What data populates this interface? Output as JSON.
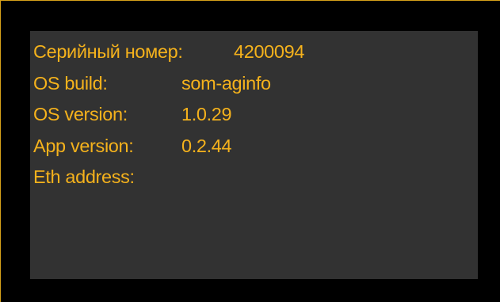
{
  "colors": {
    "background": "#000000",
    "panel": "#323232",
    "text": "#f5b21c",
    "frame_line": "#d7a21a"
  },
  "info": {
    "rows": [
      {
        "label": "Серийный номер:",
        "value": "4200094"
      },
      {
        "label": "OS build:",
        "value": "som-aginfo"
      },
      {
        "label": "OS version:",
        "value": "1.0.29"
      },
      {
        "label": "App version:",
        "value": "0.2.44"
      },
      {
        "label": "Eth address:",
        "value": ""
      }
    ]
  }
}
